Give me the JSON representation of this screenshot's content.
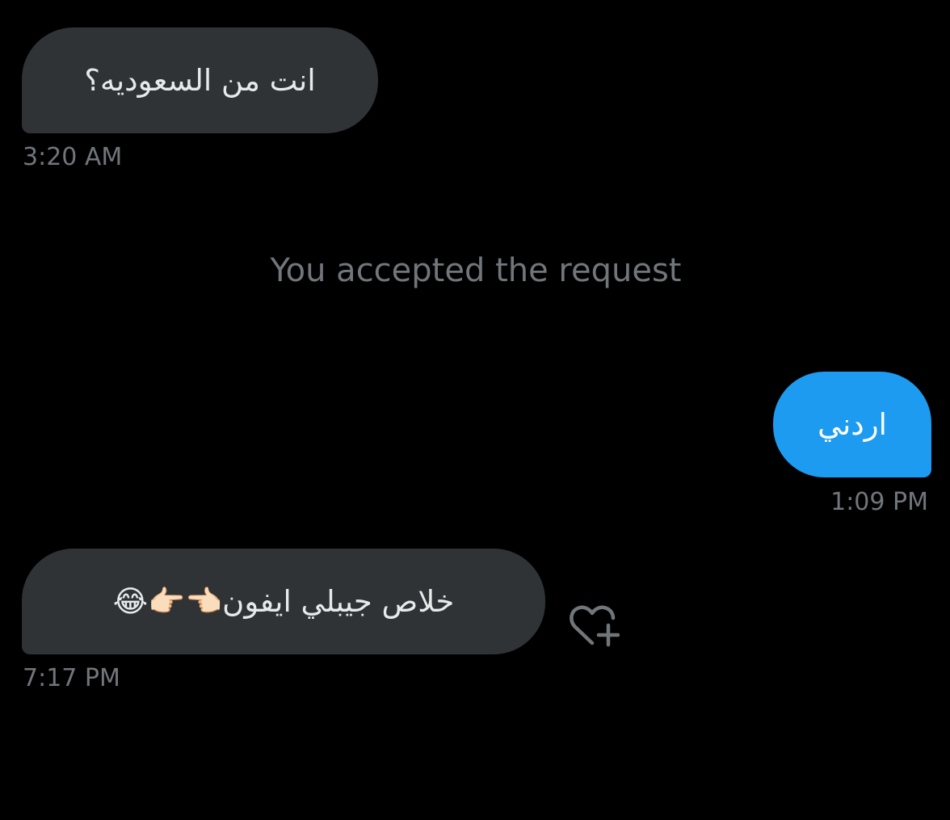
{
  "conversation": {
    "messages": [
      {
        "direction": "received",
        "text": "انت من السعوديه؟",
        "time": "3:20 AM"
      },
      {
        "direction": "system",
        "text": "You accepted the request"
      },
      {
        "direction": "sent",
        "text": "اردني",
        "time": "1:09 PM"
      },
      {
        "direction": "received",
        "text": "خلاص جيبلي ايفون👈🏻👉🏻😂",
        "time": "7:17 PM",
        "reaction_icon": "heart-plus-icon"
      }
    ]
  },
  "colors": {
    "background": "#000000",
    "received_bubble": "#2f3336",
    "sent_bubble": "#1d9bf0",
    "timestamp": "#71767b",
    "message_text": "#e7e9ea"
  }
}
